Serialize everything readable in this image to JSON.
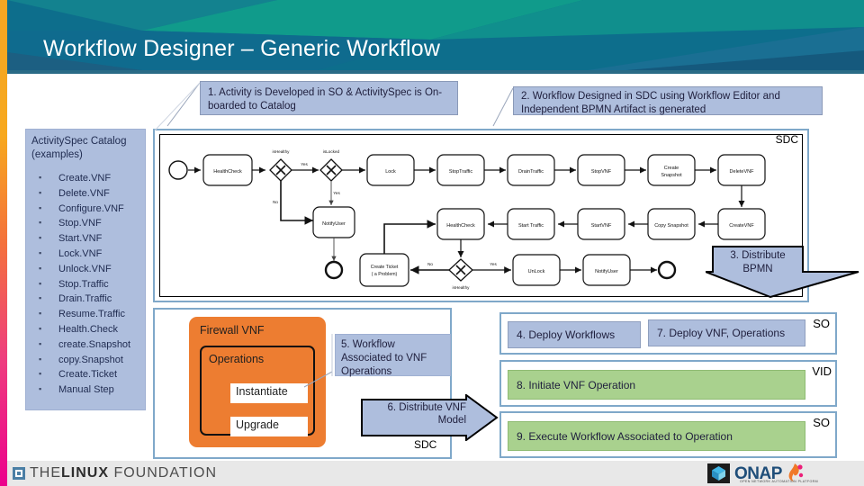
{
  "header": {
    "title": "Workflow Designer – Generic Workflow",
    "band_color": "#0d6e8c",
    "accent_rail": "#f5a623"
  },
  "callouts": {
    "c1": "1. Activity is Developed in SO & ActivitySpec is On-boarded to Catalog",
    "c2": "2. Workflow Designed in SDC using Workflow Editor and Independent BPMN Artifact is generated",
    "c5": "5. Workflow Associated to VNF Operations",
    "distribute_bpmn": "3. Distribute BPMN",
    "distribute_vnf_model": "6. Distribute VNF Model"
  },
  "activity_spec": {
    "title": "ActivitySpec Catalog (examples)",
    "items": [
      "Create.VNF",
      "Delete.VNF",
      "Configure.VNF",
      "Stop.VNF",
      "Start.VNF",
      "Lock.VNF",
      "Unlock.VNF",
      "Stop.Traffic",
      "Drain.Traffic",
      "Resume.Traffic",
      "Health.Check",
      "create.Snapshot",
      "copy.Snapshot",
      "Create.Ticket",
      "Manual Step"
    ]
  },
  "bpmn": {
    "system_tag": "SDC",
    "row1": [
      "HealthCheck",
      "Lock",
      "StopTraffic",
      "DrainTraffic",
      "StopVNF",
      "Create Snapshot",
      "DeleteVNF"
    ],
    "row2": [
      "HealthCheck",
      "Start Traffic",
      "StartVNF",
      "Copy Snapshot",
      "CreateVNF"
    ],
    "row3": [
      "Create Ticket ( a Problem)",
      "UnLock",
      "NotifyUser"
    ],
    "tasks": {
      "healthcheck1": "HealthCheck",
      "notifyuser1": "NotifyUser",
      "lock": "Lock",
      "stoptraffic": "StopTraffic",
      "draintraffic": "DrainTraffic",
      "stopvnf": "StopVNF",
      "createsnapshot": "Create Snapshot",
      "deletevnf": "DeleteVNF",
      "healthcheck2": "HealthCheck",
      "starttraffic": "Start Traffic",
      "startvnf": "StartVNF",
      "copysnapshot": "Copy Snapshot",
      "createvnf": "CreateVNF",
      "createticket": "Create Ticket",
      "createticket2": "( a Problem)",
      "unlock": "UnLock",
      "notifyuser2": "NotifyUser"
    },
    "gateways": {
      "g1": "isHealthy",
      "g2": "isLocked",
      "g3": "isHealthy"
    },
    "flow_labels": {
      "yes1": "Yes",
      "no1": "No",
      "yes2": "Yes",
      "no2": "No",
      "yes3": "Yes"
    }
  },
  "vnf": {
    "title": "Firewall VNF",
    "operations_title": "Operations",
    "operations": [
      "Instantiate",
      "Upgrade"
    ],
    "system_tag": "SDC"
  },
  "right_panels": [
    {
      "chips": [
        {
          "label": "4. Deploy Workflows",
          "color": "blue"
        },
        {
          "label": "7. Deploy VNF, Operations",
          "color": "blue"
        }
      ],
      "system_tag": "SO"
    },
    {
      "chips": [
        {
          "label": "8. Initiate VNF Operation",
          "color": "green"
        }
      ],
      "system_tag": "VID"
    },
    {
      "chips": [
        {
          "label": "9. Execute Workflow Associated to Operation",
          "color": "green"
        }
      ],
      "system_tag": "SO"
    }
  ],
  "footer": {
    "linux_foundation_pre": "THE",
    "linux_foundation_bold": "LINUX",
    "linux_foundation_post": "FOUNDATION",
    "onap_word": "ONAP",
    "onap_tagline": "OPEN NETWORK AUTOMATION PLATFORM"
  }
}
